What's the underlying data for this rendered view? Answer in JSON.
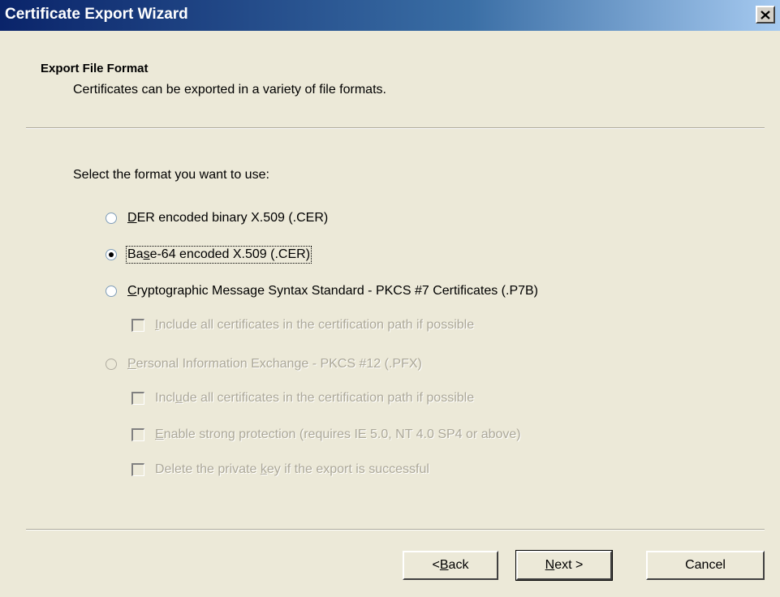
{
  "window": {
    "title": "Certificate Export Wizard"
  },
  "header": {
    "title": "Export File Format",
    "subtitle": "Certificates can be exported in a variety of file formats."
  },
  "prompt": "Select the format you want to use:",
  "options": [
    {
      "label_pre": "",
      "label_key": "D",
      "label_post": "ER encoded binary X.509 (.CER)",
      "selected": false,
      "enabled": true
    },
    {
      "label_pre": "Ba",
      "label_key": "s",
      "label_post": "e-64 encoded X.509 (.CER)",
      "selected": true,
      "enabled": true
    },
    {
      "label_pre": "",
      "label_key": "C",
      "label_post": "ryptographic Message Syntax Standard - PKCS #7 Certificates (.P7B)",
      "selected": false,
      "enabled": true
    },
    {
      "label_pre": "",
      "label_key": "P",
      "label_post": "ersonal Information Exchange - PKCS #12 (.PFX)",
      "selected": false,
      "enabled": false
    }
  ],
  "checkboxes": [
    {
      "label_pre": "",
      "label_key": "I",
      "label_post": "nclude all certificates in the certification path if possible",
      "checked": false,
      "enabled": false
    },
    {
      "label_pre": "Incl",
      "label_key": "u",
      "label_post": "de all certificates in the certification path if possible",
      "checked": false,
      "enabled": false
    },
    {
      "label_pre": "",
      "label_key": "E",
      "label_post": "nable strong protection (requires IE 5.0, NT 4.0 SP4 or above)",
      "checked": false,
      "enabled": false
    },
    {
      "label_pre": "Delete the private ",
      "label_key": "k",
      "label_post": "ey if the export is successful",
      "checked": false,
      "enabled": false
    }
  ],
  "buttons": {
    "back": {
      "pre": "< ",
      "key": "B",
      "post": "ack"
    },
    "next": {
      "pre": "",
      "key": "N",
      "post": "ext >"
    },
    "cancel": "Cancel"
  },
  "icons": {
    "close": "close-icon"
  }
}
